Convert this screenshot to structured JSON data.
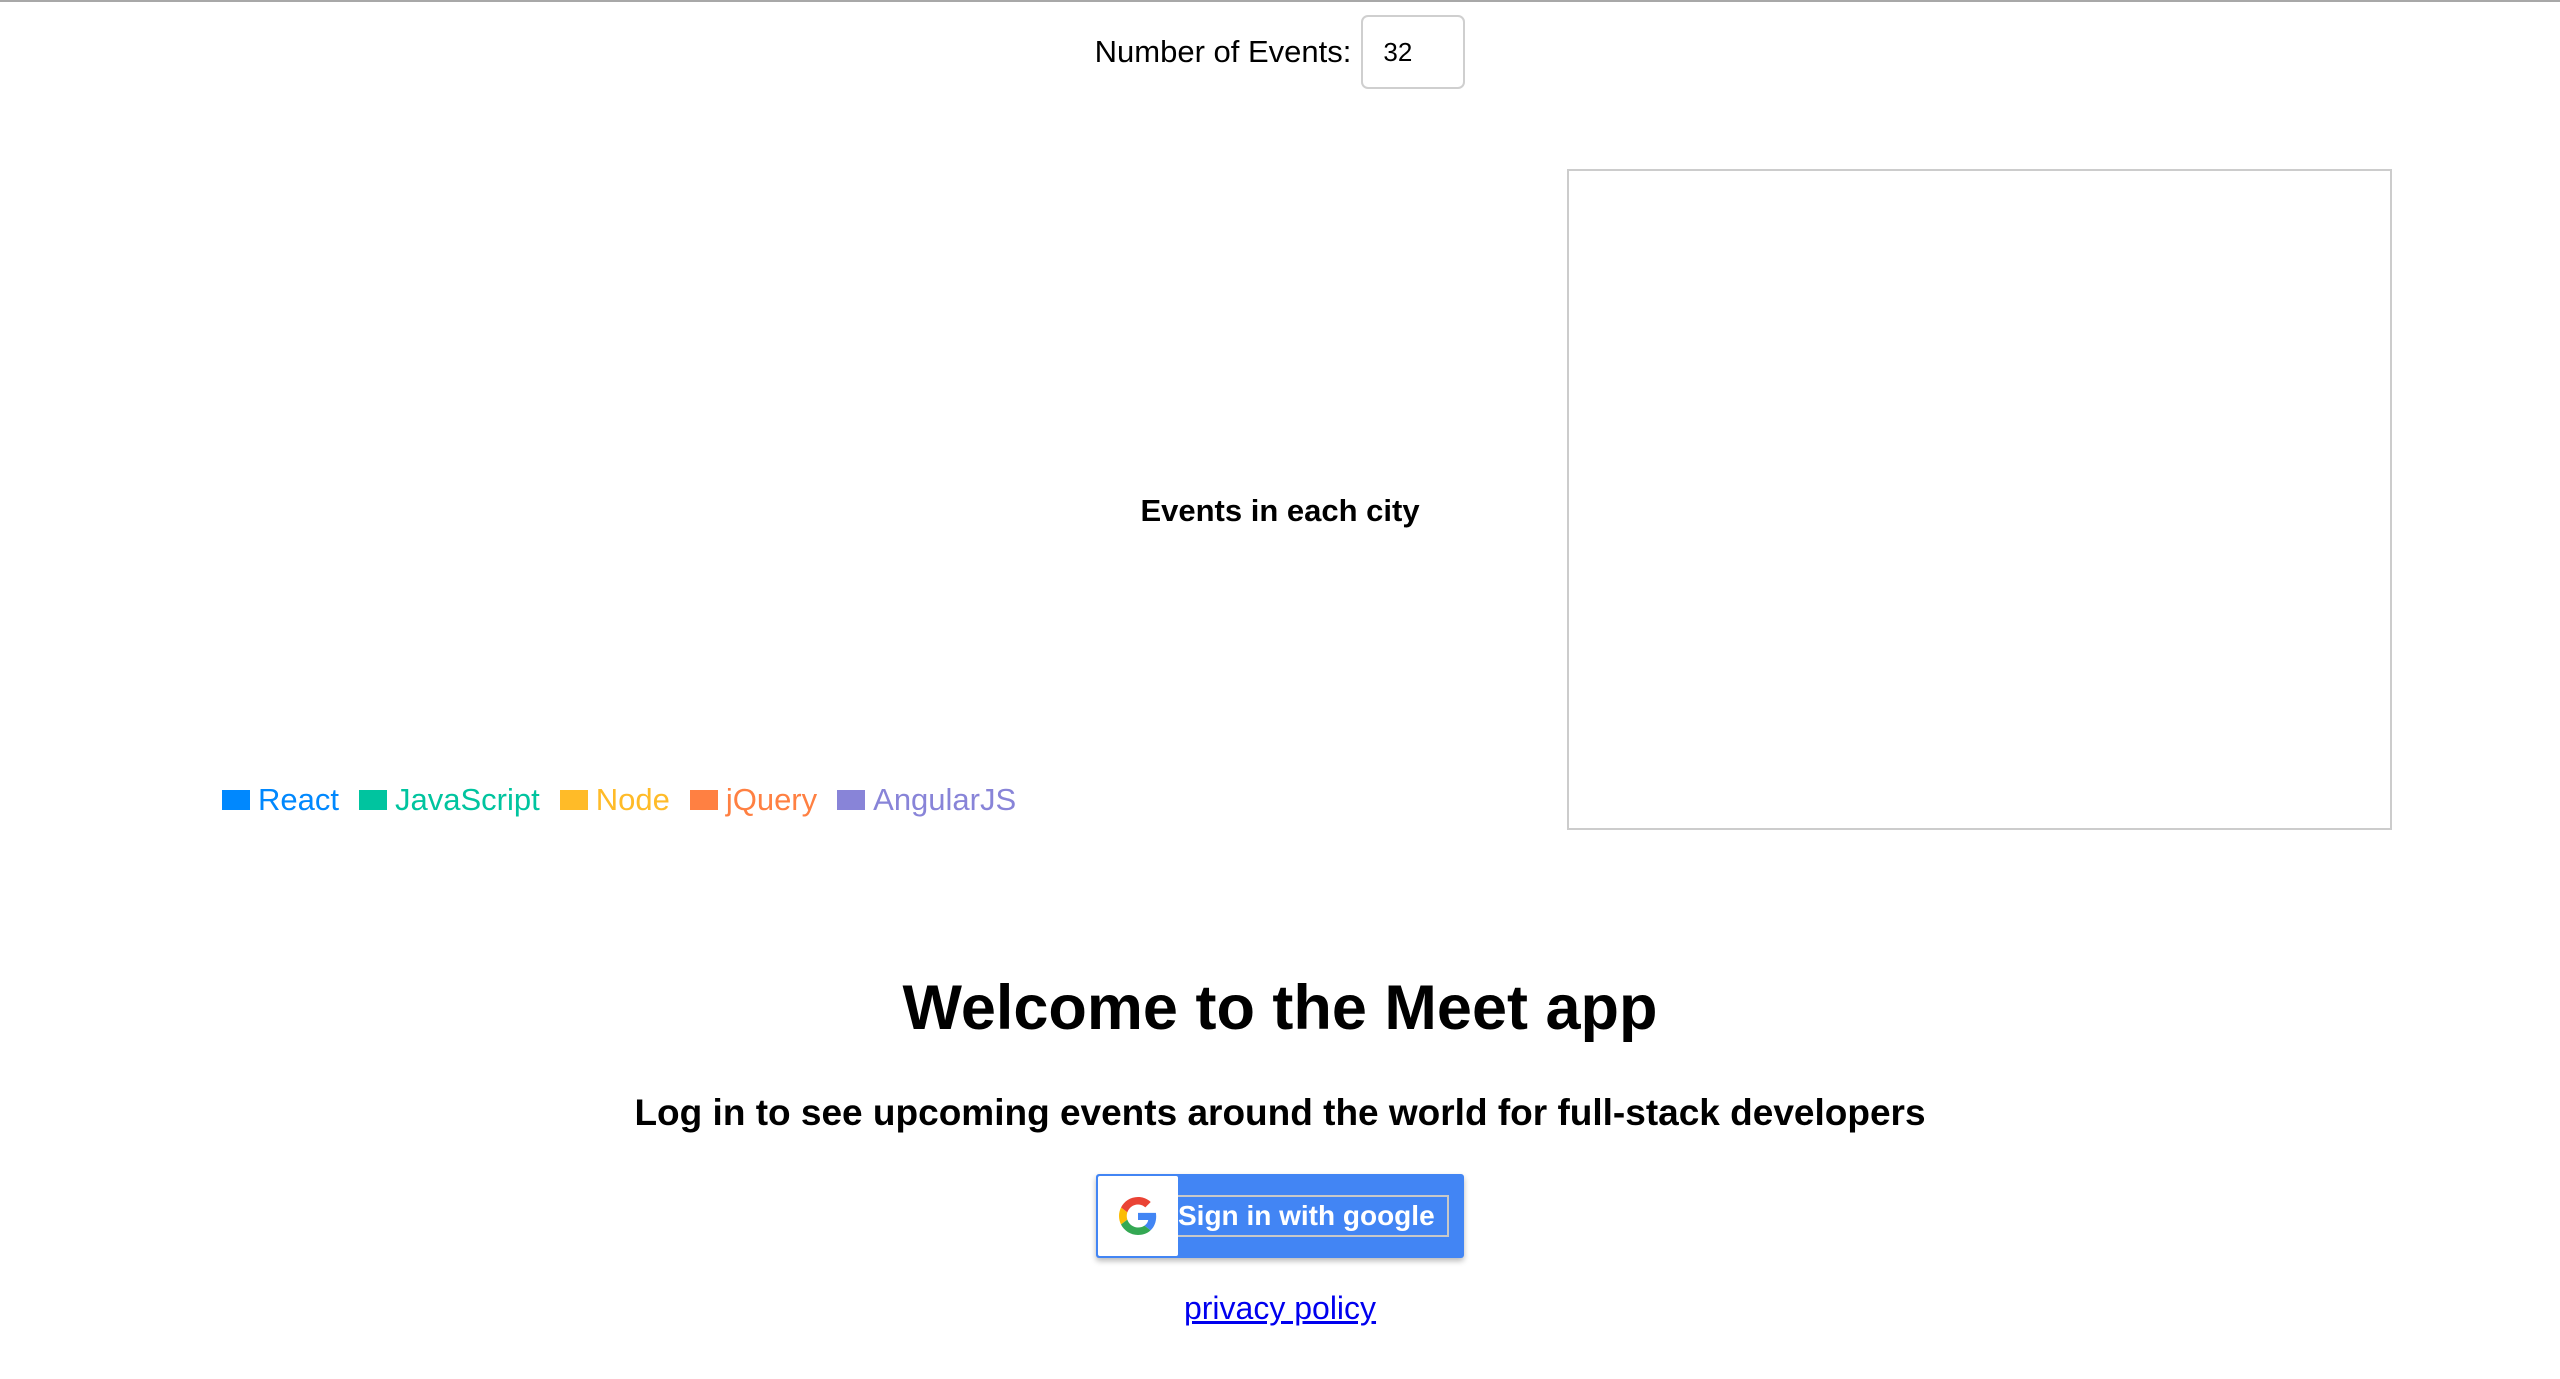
{
  "number_of_events": {
    "label": "Number of Events:",
    "value": "32"
  },
  "chart": {
    "title": "Events in each city"
  },
  "legend": {
    "items": [
      {
        "label": "React",
        "color": "#0088fe"
      },
      {
        "label": "JavaScript",
        "color": "#00c49f"
      },
      {
        "label": "Node",
        "color": "#ffbb28"
      },
      {
        "label": "jQuery",
        "color": "#ff8042"
      },
      {
        "label": "AngularJS",
        "color": "#8884d8"
      }
    ]
  },
  "welcome": {
    "title": "Welcome to the Meet app",
    "subtitle": "Log in to see upcoming events around the world for full-stack developers"
  },
  "google_button": {
    "label": "Sign in with google",
    "icon": "google-g-icon",
    "color": "#4285f4"
  },
  "privacy_policy": {
    "label": "privacy policy"
  }
}
